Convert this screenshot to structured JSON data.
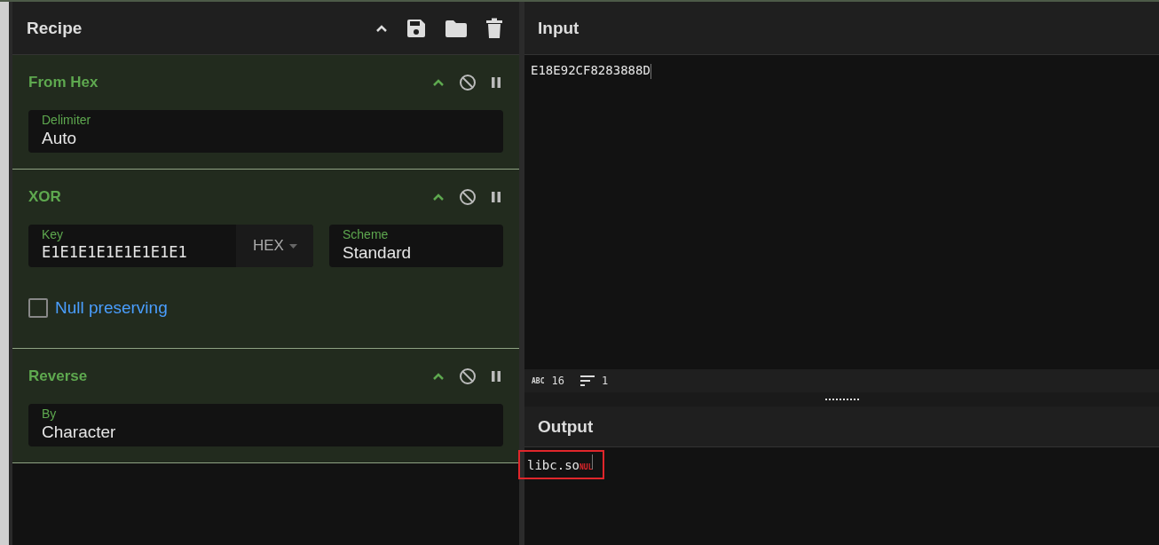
{
  "recipe": {
    "title": "Recipe",
    "operations": [
      {
        "name": "From Hex",
        "fields": [
          {
            "kind": "text",
            "label": "Delimiter",
            "value": "Auto"
          }
        ]
      },
      {
        "name": "XOR",
        "fields": [
          {
            "kind": "key",
            "label": "Key",
            "value": "E1E1E1E1E1E1E1E1",
            "format": "HEX"
          },
          {
            "kind": "text",
            "label": "Scheme",
            "value": "Standard"
          },
          {
            "kind": "checkbox",
            "label": "Null preserving",
            "checked": false
          }
        ]
      },
      {
        "name": "Reverse",
        "fields": [
          {
            "kind": "text",
            "label": "By",
            "value": "Character"
          }
        ]
      }
    ]
  },
  "input": {
    "title": "Input",
    "text": "E18E92CF8283888D",
    "stats": {
      "length_label": "ABC",
      "length": "16",
      "lines": "1"
    }
  },
  "output": {
    "title": "Output",
    "text": "libc.so",
    "control_char": "NUL",
    "highlighted": true
  }
}
